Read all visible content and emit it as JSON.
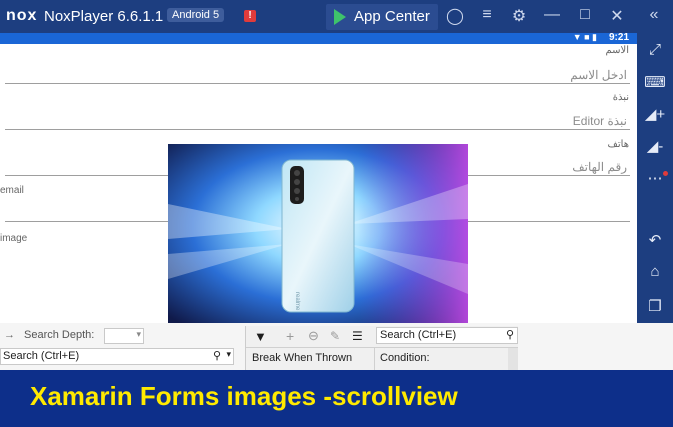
{
  "titlebar": {
    "logo": "nox",
    "title": "NoxPlayer 6.6.1.1",
    "android_badge": "Android 5",
    "alert_badge": "!",
    "app_center": "App Center",
    "icons": [
      "shirt-icon",
      "menu-icon",
      "gear-icon",
      "minimize-icon",
      "maximize-icon",
      "close-icon",
      "collapse-icon"
    ]
  },
  "statusbar": {
    "time": "9:21",
    "icons": "wifi-icon signal-icon battery-icon"
  },
  "form": {
    "name_label": "الاسم",
    "name_hint": "ادخل الاسم",
    "bio_label": "نبذة",
    "bio_hint": "Editor نبذة",
    "phone_label": "هاتف",
    "phone_hint": "رقم الهاتف",
    "email_label": "email",
    "image_label": "image"
  },
  "phone_image": {
    "brand_text": "realme"
  },
  "vs_panel": {
    "search_depth_label": "Search Depth:",
    "search_placeholder_left": "Search (Ctrl+E)",
    "search_placeholder_right": "Search (Ctrl+E)",
    "col_break_when_thrown": "Break When Thrown",
    "col_condition": "Condition:"
  },
  "caption": {
    "text": "Xamarin Forms images -scrollview"
  },
  "colors": {
    "title_bar": "#1d3e80",
    "status_bar": "#1a66d6",
    "caption_bg": "#0d2f8a",
    "caption_text": "#ffea00",
    "app_center_play": "#3ec36b"
  }
}
